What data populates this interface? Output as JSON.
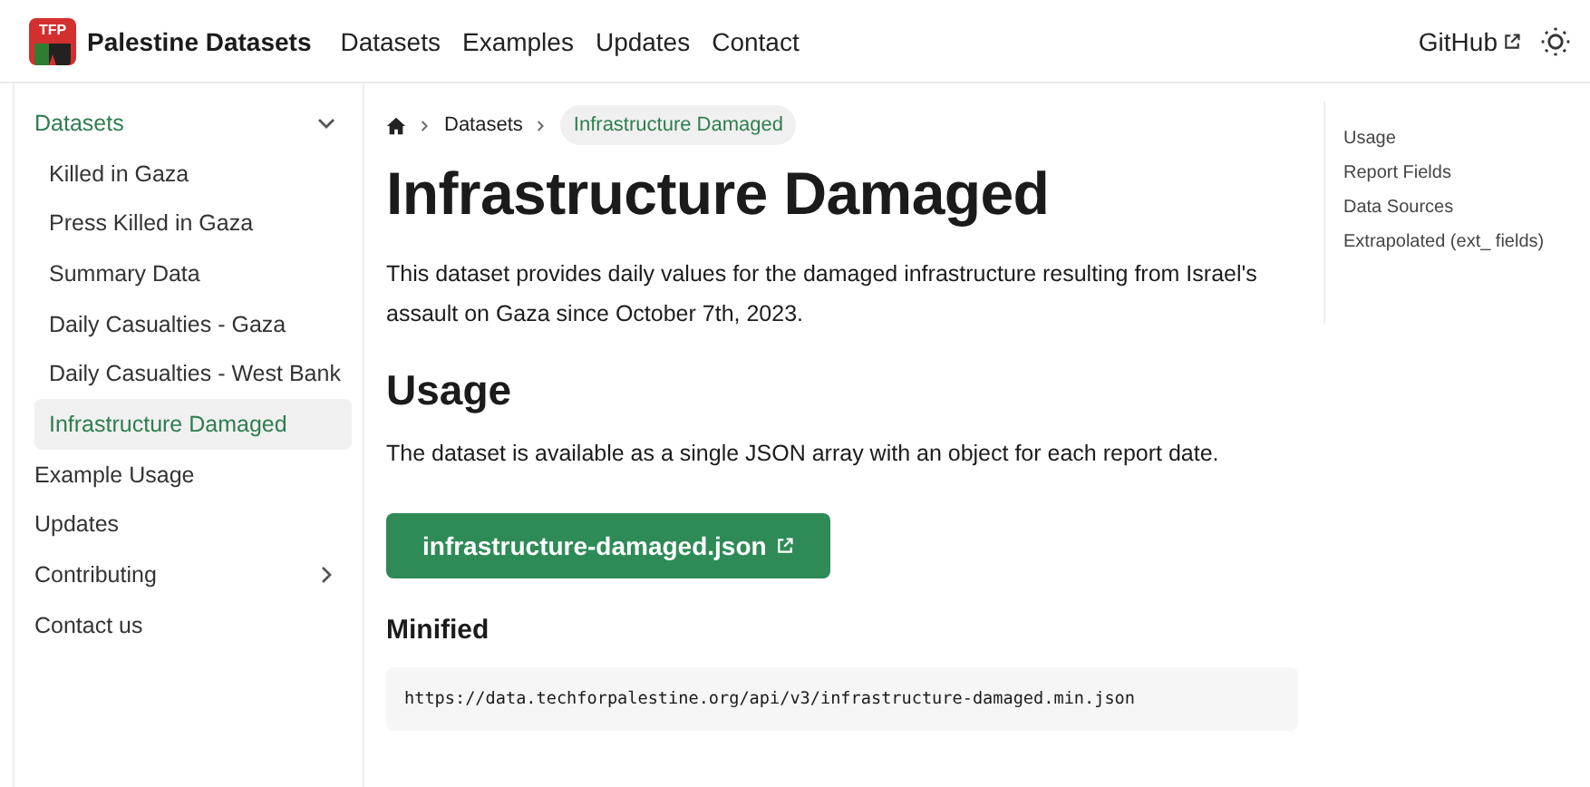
{
  "header": {
    "logo_text": "TFP",
    "site_title": "Palestine Datasets",
    "nav": [
      "Datasets",
      "Examples",
      "Updates",
      "Contact"
    ],
    "github": "GitHub"
  },
  "sidebar": {
    "items": [
      {
        "label": "Datasets",
        "kind": "group",
        "expanded": true,
        "selected": false,
        "children": [
          {
            "label": "Killed in Gaza",
            "selected": false
          },
          {
            "label": "Press Killed in Gaza",
            "selected": false
          },
          {
            "label": "Summary Data",
            "selected": false
          },
          {
            "label": "Daily Casualties - Gaza",
            "selected": false
          },
          {
            "label": "Daily Casualties - West Bank",
            "selected": false
          },
          {
            "label": "Infrastructure Damaged",
            "selected": true
          }
        ]
      },
      {
        "label": "Example Usage",
        "kind": "link",
        "selected": false
      },
      {
        "label": "Updates",
        "kind": "link",
        "selected": false
      },
      {
        "label": "Contributing",
        "kind": "group",
        "expanded": false,
        "selected": false
      },
      {
        "label": "Contact us",
        "kind": "link",
        "selected": false
      }
    ]
  },
  "breadcrumbs": [
    "Datasets",
    "Infrastructure Damaged"
  ],
  "title": "Infrastructure Damaged",
  "intro": "This dataset provides daily values for the damaged infrastructure resulting from Israel's assault on Gaza since October 7th, 2023.",
  "usage": {
    "heading": "Usage",
    "text": "The dataset is available as a single JSON array with an object for each report date.",
    "button": "infrastructure-damaged.json",
    "subheading": "Minified",
    "code": "https://data.techforpalestine.org/api/v3/infrastructure-damaged.min.json"
  },
  "toc": [
    "Usage",
    "Report Fields",
    "Data Sources",
    "Extrapolated (ext_ fields)"
  ]
}
